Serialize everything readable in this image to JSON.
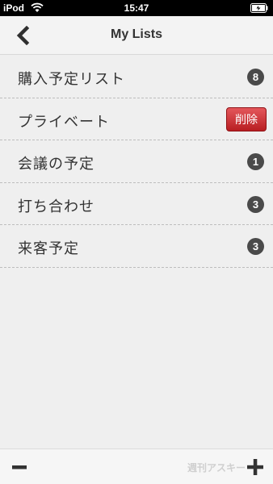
{
  "status_bar": {
    "carrier": "iPod",
    "time": "15:47",
    "wifi_icon": "wifi-icon",
    "battery_icon": "battery-icon"
  },
  "nav": {
    "title": "My Lists",
    "back_icon": "chevron-left-icon"
  },
  "lists": [
    {
      "label": "購入予定リスト",
      "count": "8"
    },
    {
      "label": "プライベート",
      "delete_label": "削除"
    },
    {
      "label": "会議の予定",
      "count": "1"
    },
    {
      "label": "打ち合わせ",
      "count": "3"
    },
    {
      "label": "来客予定",
      "count": "3"
    }
  ],
  "toolbar": {
    "minus_icon": "minus-icon",
    "plus_icon": "plus-icon",
    "watermark": "週刊アスキー"
  },
  "colors": {
    "background": "#efefef",
    "badge": "#4a4a4a",
    "delete": "#c9272b"
  }
}
